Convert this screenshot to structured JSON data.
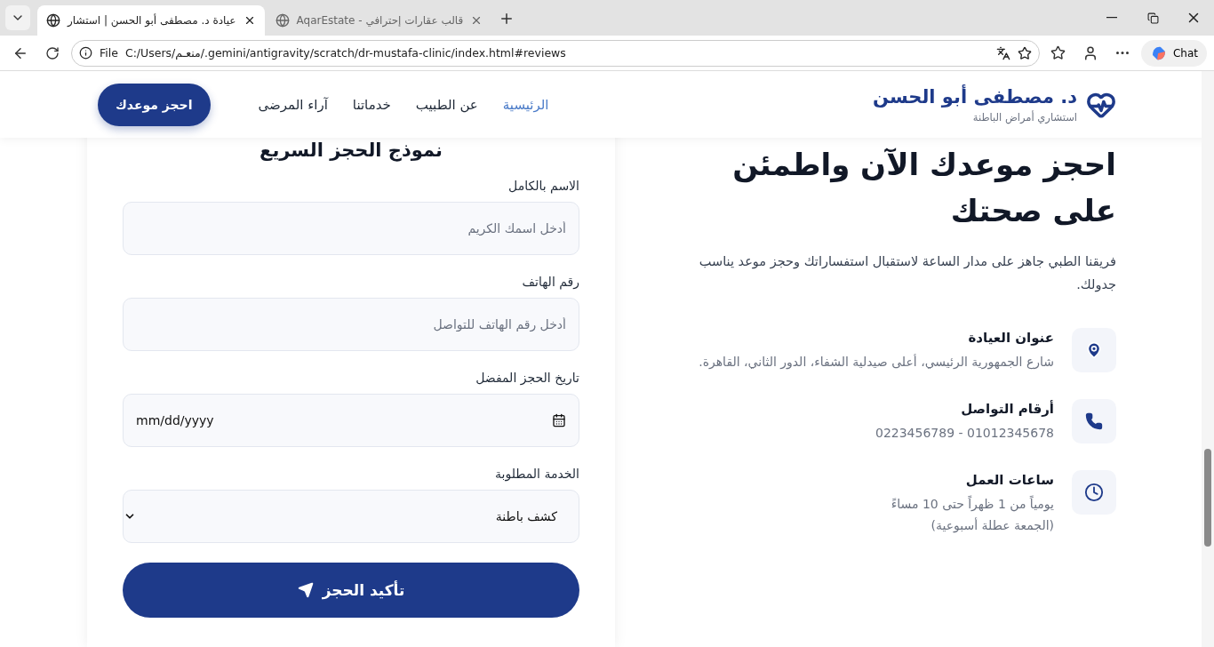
{
  "browser": {
    "left_tab": {
      "title": "عيادة د. مصطفى أبو الحسن | استشار",
      "selected": true
    },
    "right_tab": {
      "title": "قالب عقارات إحترافي - AqarEstate",
      "selected": false
    },
    "address": {
      "scheme": "File",
      "url": "C:/Users/منعـم/.gemini/antigravity/scratch/dr-mustafa-clinic/index.html#reviews"
    },
    "chat_label": "Chat"
  },
  "header": {
    "brand": {
      "name": "د. مصطفى أبو الحسن",
      "subtitle": "استشاري أمراض الباطنة"
    },
    "nav": [
      {
        "label": "الرئيسية",
        "selected": true
      },
      {
        "label": "عن الطبيب",
        "selected": false
      },
      {
        "label": "خدماتنا",
        "selected": false
      },
      {
        "label": "آراء المرضى",
        "selected": false
      }
    ],
    "cta": "احجز موعدك"
  },
  "hero": {
    "title": "احجز موعدك الآن واطمئن على صحتك",
    "intro": "فريقنا الطبي جاهز على مدار الساعة لاستقبال استفساراتك وحجز موعد يناسب جدولك."
  },
  "contacts": [
    {
      "kind": "location",
      "title": "عنوان العيادة",
      "lines": [
        "شارع الجمهورية الرئيسي، أعلى صيدلية الشفاء، الدور الثاني، القاهرة."
      ]
    },
    {
      "kind": "phone",
      "title": "أرقام التواصل",
      "lines": [
        "01012345678 - 0223456789"
      ]
    },
    {
      "kind": "clock",
      "title": "ساعات العمل",
      "lines": [
        "يومياً من 1 ظهراً حتى 10 مساءً",
        "(الجمعة عطلة أسبوعية)"
      ]
    }
  ],
  "form": {
    "title": "نموذج الحجز السريع",
    "fields": [
      {
        "kind": "text",
        "label": "الاسم بالكامل",
        "placeholder": "أدخل اسمك الكريم"
      },
      {
        "kind": "text",
        "label": "رقم الهاتف",
        "placeholder": "أدخل رقم الهاتف للتواصل"
      },
      {
        "kind": "date",
        "label": "تاريخ الحجز المفضل",
        "placeholder": "mm/dd/yyyy"
      },
      {
        "kind": "select",
        "label": "الخدمة المطلوبة",
        "value": "كشف باطنة"
      }
    ],
    "submit": "تأكيد الحجز"
  }
}
